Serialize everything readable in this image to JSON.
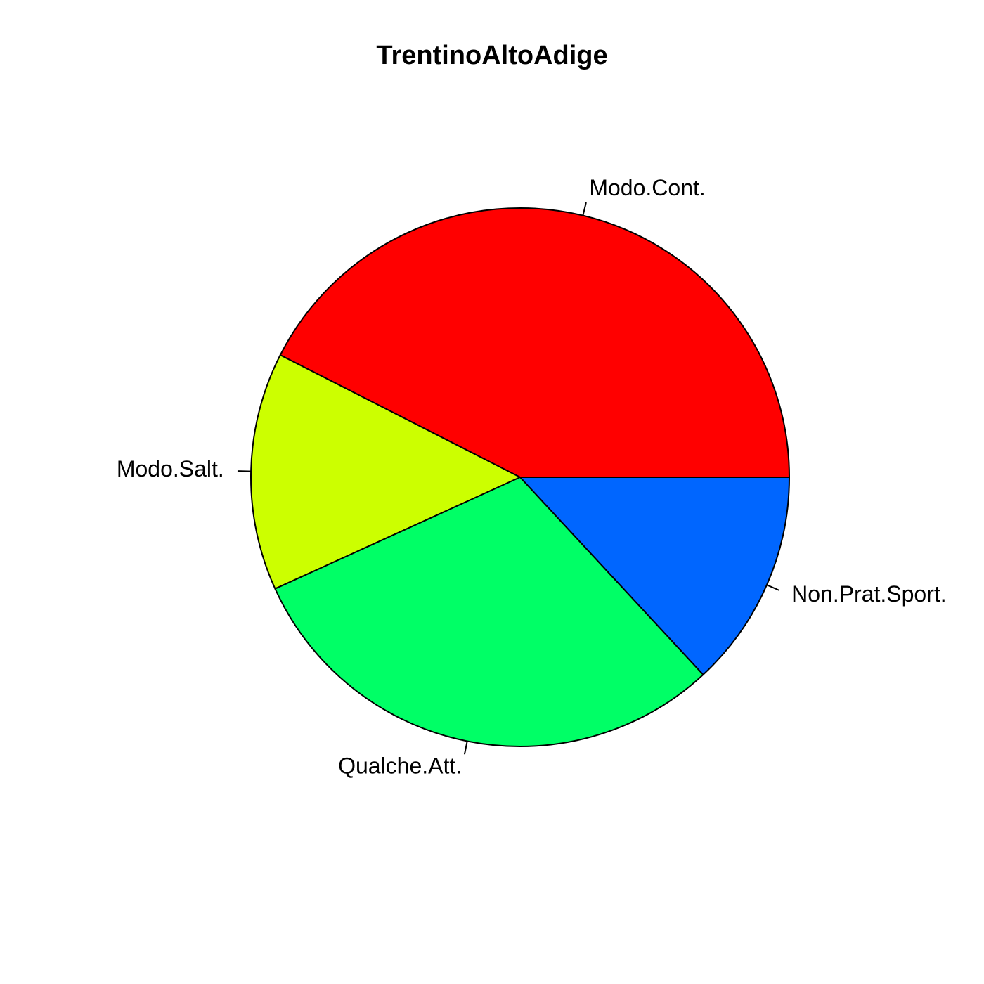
{
  "chart_data": {
    "type": "pie",
    "title": "TrentinoAltoAdige",
    "direction": "counterclockwise",
    "start": "3 o'clock",
    "slices": [
      {
        "label": "Modo.Cont.",
        "value": 42.5,
        "color": "#FF0000"
      },
      {
        "label": "Modo.Salt.",
        "value": 14.3,
        "color": "#CCFF00"
      },
      {
        "label": "Qualche.Att.",
        "value": 30.1,
        "color": "#00FF66"
      },
      {
        "label": "Non.Prat.Sport.",
        "value": 13.1,
        "color": "#0066FF"
      }
    ]
  }
}
